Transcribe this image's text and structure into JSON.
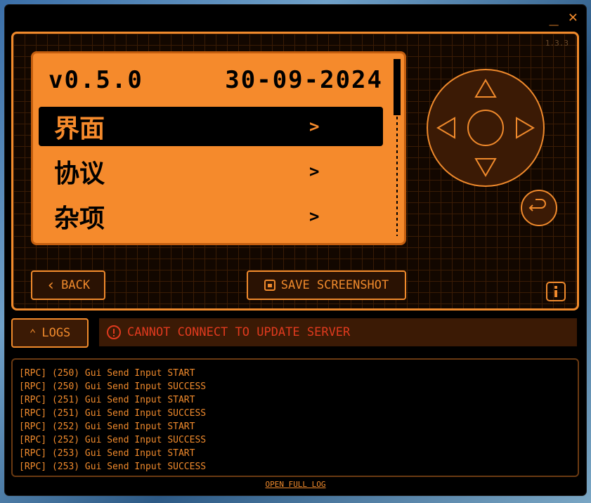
{
  "window": {
    "minimize_label": "_",
    "close_label": "✕"
  },
  "device": {
    "version_small": "1.3.3",
    "screen": {
      "version": "v0.5.0",
      "date": "30-09-2024",
      "menu": [
        {
          "label": "界面",
          "arrow": ">",
          "selected": true
        },
        {
          "label": "协议",
          "arrow": ">",
          "selected": false
        },
        {
          "label": "杂项",
          "arrow": ">",
          "selected": false
        }
      ]
    },
    "back_label": "BACK",
    "save_screenshot_label": "SAVE SCREENSHOT"
  },
  "logs_button_label": "LOGS",
  "status_message": "CANNOT CONNECT TO UPDATE SERVER",
  "log_lines": [
    "[RPC] (250) Gui Send Input START",
    "[RPC] (250) Gui Send Input SUCCESS",
    "[RPC] (251) Gui Send Input START",
    "[RPC] (251) Gui Send Input SUCCESS",
    "[RPC] (252) Gui Send Input START",
    "[RPC] (252) Gui Send Input SUCCESS",
    "[RPC] (253) Gui Send Input START",
    "[RPC] (253) Gui Send Input SUCCESS"
  ],
  "open_full_log_label": "OPEN FULL LOG",
  "colors": {
    "accent": "#f08a2c",
    "screen_bg": "#f58a2c",
    "error": "#e03a1e"
  }
}
